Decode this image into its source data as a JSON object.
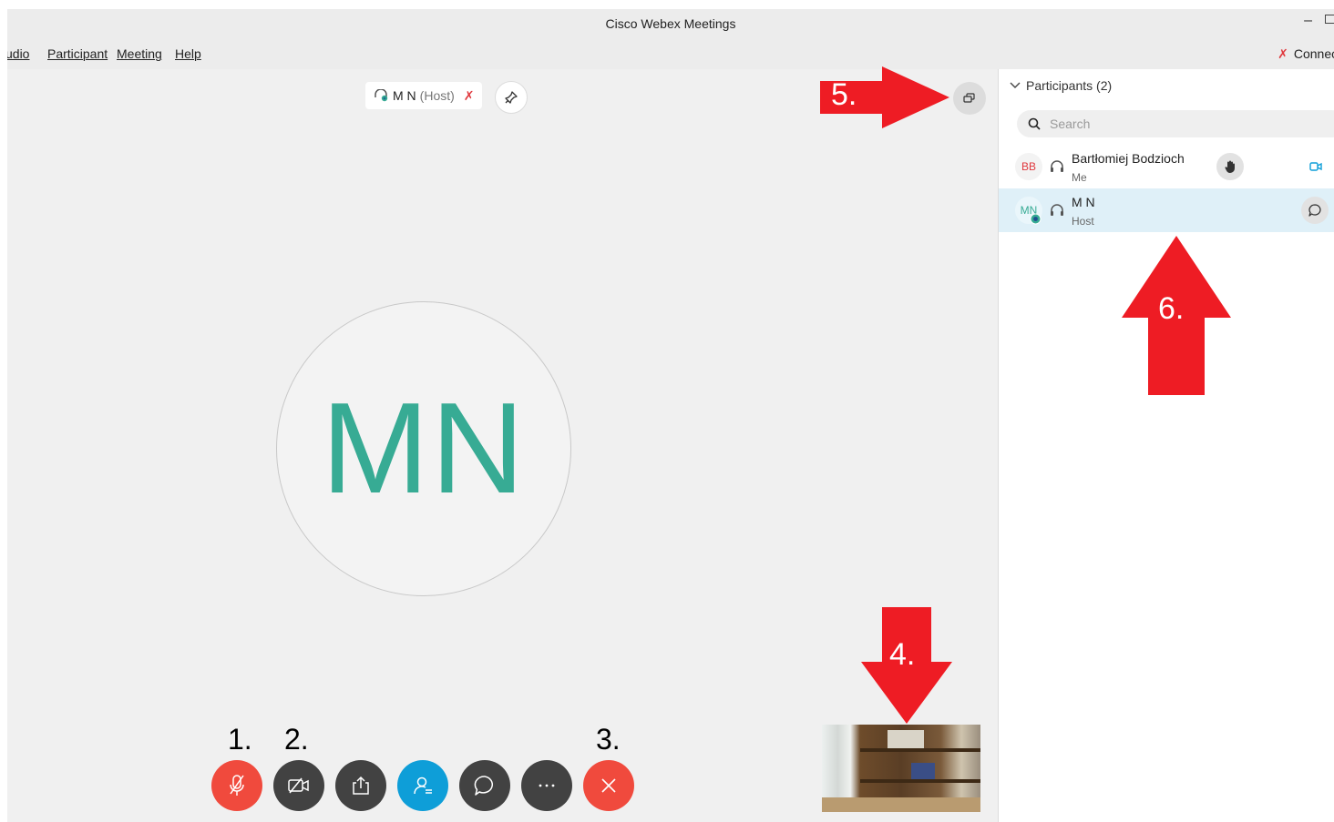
{
  "window": {
    "title": "Cisco Webex Meetings",
    "minimize_symbol": "–"
  },
  "menu": {
    "items": [
      "udio",
      "Participant",
      "Meeting",
      "Help"
    ],
    "connection_label": "Connect"
  },
  "stage": {
    "active_speaker": {
      "name": "M N",
      "role": "(Host)",
      "muted": true
    },
    "avatar_initials": "MN",
    "avatar_color": "#37ab94"
  },
  "controls": [
    {
      "name": "mute",
      "icon": "muted-microphone-icon",
      "color": "#f04a3d"
    },
    {
      "name": "video",
      "icon": "video-off-icon",
      "color": "#424242"
    },
    {
      "name": "share",
      "icon": "share-icon",
      "color": "#424242"
    },
    {
      "name": "participants",
      "icon": "participants-icon",
      "color": "#0e9ed8"
    },
    {
      "name": "chat",
      "icon": "chat-icon",
      "color": "#424242"
    },
    {
      "name": "more",
      "icon": "more-icon",
      "color": "#424242"
    },
    {
      "name": "leave",
      "icon": "close-icon",
      "color": "#f04a3d"
    }
  ],
  "panel": {
    "header": "Participants (2)",
    "search_placeholder": "Search",
    "participants": [
      {
        "initials": "BB",
        "name": "Bartłomiej Bodzioch",
        "role": "Me",
        "initials_color": "#e0393e"
      },
      {
        "initials": "MN",
        "name": "M N",
        "role": "Host",
        "initials_color": "#37ab94"
      }
    ]
  },
  "annotations": [
    "1.",
    "2.",
    "3.",
    "4.",
    "5.",
    "6."
  ],
  "annotation_color": "#ee1c24"
}
